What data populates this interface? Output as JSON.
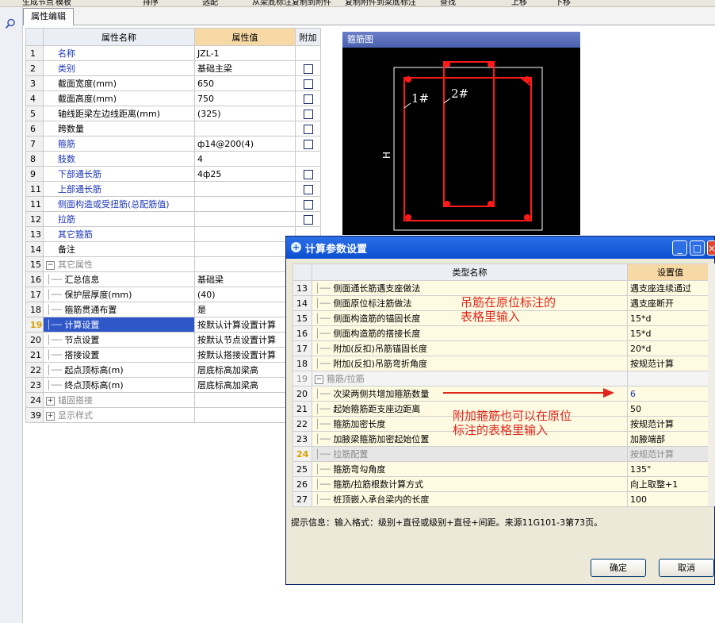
{
  "toolbar": {
    "items": [
      "生成节点",
      "模板",
      "排序",
      "选配",
      "从梁底标注复制到附件",
      "复制附件到梁底标注",
      "查找",
      "上移",
      "下移"
    ]
  },
  "tabs": [
    {
      "label": "属性编辑"
    }
  ],
  "property_grid": {
    "headers": {
      "name": "属性名称",
      "value": "属性值",
      "extra": "附加"
    },
    "rows": [
      {
        "num": "1",
        "name": "名称",
        "value": "JZL-1",
        "style": "blue",
        "checkbox": false
      },
      {
        "num": "2",
        "name": "类别",
        "value": "基础主梁",
        "style": "blue",
        "checkbox": true
      },
      {
        "num": "3",
        "name": "截面宽度(mm)",
        "value": "650",
        "style": "",
        "checkbox": true
      },
      {
        "num": "4",
        "name": "截面高度(mm)",
        "value": "750",
        "style": "",
        "checkbox": true
      },
      {
        "num": "5",
        "name": "轴线距梁左边线距离(mm)",
        "value": "(325)",
        "style": "",
        "checkbox": true
      },
      {
        "num": "6",
        "name": "跨数量",
        "value": "",
        "style": "",
        "checkbox": true
      },
      {
        "num": "7",
        "name": "箍筋",
        "value": "ф14@200(4)",
        "style": "blue",
        "checkbox": true
      },
      {
        "num": "8",
        "name": "肢数",
        "value": "4",
        "style": "blue",
        "checkbox": false
      },
      {
        "num": "9",
        "name": "下部通长筋",
        "value": "4ф25",
        "style": "blue",
        "checkbox": true
      },
      {
        "num": "11",
        "name": "上部通长筋",
        "value": "",
        "style": "blue",
        "checkbox": true
      },
      {
        "num": "11",
        "name": "侧面构造或受扭筋(总配筋值)",
        "value": "",
        "style": "blue",
        "checkbox": true
      },
      {
        "num": "12",
        "name": "拉筋",
        "value": "",
        "style": "blue",
        "checkbox": true
      },
      {
        "num": "13",
        "name": "其它箍筋",
        "value": "",
        "style": "blue",
        "checkbox": false
      },
      {
        "num": "14",
        "name": "备注",
        "value": "",
        "style": "",
        "checkbox": false
      },
      {
        "num": "15",
        "name": "其它属性",
        "value": "",
        "style": "group",
        "toggle": "−",
        "checkbox": false
      },
      {
        "num": "16",
        "name": "汇总信息",
        "value": "基础梁",
        "style": "child",
        "checkbox": false
      },
      {
        "num": "17",
        "name": "保护层厚度(mm)",
        "value": "(40)",
        "style": "child",
        "checkbox": false
      },
      {
        "num": "18",
        "name": "箍筋贯通布置",
        "value": "是",
        "style": "child",
        "checkbox": false
      },
      {
        "num": "19",
        "name": "计算设置",
        "value": "按默认计算设置计算",
        "style": "selected",
        "checkbox": false
      },
      {
        "num": "20",
        "name": "节点设置",
        "value": "按默认节点设置计算",
        "style": "child",
        "checkbox": false
      },
      {
        "num": "21",
        "name": "搭接设置",
        "value": "按默认搭接设置计算",
        "style": "child",
        "checkbox": false
      },
      {
        "num": "22",
        "name": "起点顶标高(m)",
        "value": "层底标高加梁高",
        "style": "child",
        "checkbox": false
      },
      {
        "num": "23",
        "name": "终点顶标高(m)",
        "value": "层底标高加梁高",
        "style": "child",
        "checkbox": false
      },
      {
        "num": "24",
        "name": "锚固搭接",
        "value": "",
        "style": "group",
        "toggle": "+",
        "checkbox": false
      },
      {
        "num": "39",
        "name": "显示样式",
        "value": "",
        "style": "group",
        "toggle": "+",
        "checkbox": false
      }
    ]
  },
  "stirrup_diagram": {
    "title": "箍筋图",
    "label_1": "1#",
    "label_2": "2#",
    "label_h": "H"
  },
  "dialog": {
    "title": "计算参数设置",
    "headers": {
      "name": "类型名称",
      "value": "设置值"
    },
    "rows": [
      {
        "num": "13",
        "name": "侧面通长筋遇支座做法",
        "value": "遇支座连续通过",
        "style": ""
      },
      {
        "num": "14",
        "name": "侧面原位标注筋做法",
        "value": "遇支座断开",
        "style": ""
      },
      {
        "num": "15",
        "name": "侧面构造筋的锚固长度",
        "value": "15*d",
        "style": ""
      },
      {
        "num": "16",
        "name": "侧面构造筋的搭接长度",
        "value": "15*d",
        "style": ""
      },
      {
        "num": "17",
        "name": "附加(反扣)吊筋锚固长度",
        "value": "20*d",
        "style": ""
      },
      {
        "num": "18",
        "name": "附加(反扣)吊筋弯折角度",
        "value": "按规范计算",
        "style": ""
      },
      {
        "num": "19",
        "name": "箍筋/拉筋",
        "value": "",
        "style": "group",
        "toggle": "−"
      },
      {
        "num": "20",
        "name": "次梁两侧共增加箍筋数量",
        "value": "6",
        "style": "blue"
      },
      {
        "num": "21",
        "name": "起始箍筋距支座边距离",
        "value": "50",
        "style": ""
      },
      {
        "num": "22",
        "name": "箍筋加密长度",
        "value": "按规范计算",
        "style": ""
      },
      {
        "num": "23",
        "name": "加腋梁箍筋加密起始位置",
        "value": "加腋端部",
        "style": ""
      },
      {
        "num": "24",
        "name": "拉筋配置",
        "value": "按规范计算",
        "style": "disabled"
      },
      {
        "num": "25",
        "name": "箍筋弯勾角度",
        "value": "135°",
        "style": ""
      },
      {
        "num": "26",
        "name": "箍筋/拉筋根数计算方式",
        "value": "向上取整+1",
        "style": ""
      },
      {
        "num": "27",
        "name": "桩顶嵌入承台梁内的长度",
        "value": "100",
        "style": ""
      }
    ],
    "hint": "提示信息：输入格式：级别+直径或级别+直径+间距。来源11G101-3第73页。",
    "ok_label": "确定",
    "cancel_label": "取消",
    "minimize_label": "_",
    "maximize_label": "□",
    "close_label": "×"
  },
  "annotations": {
    "note1_line1": "吊筋在原位标注的",
    "note1_line2": "表格里输入",
    "note2_line1": "附加箍筋也可以在原位",
    "note2_line2": "标注的表格里输入"
  },
  "colors": {
    "annotation": "#e0261c",
    "rebar": "#ff1a1a",
    "header_value": "#f7d9a5",
    "selection": "#2f57c8",
    "link_text": "#1c36b7"
  }
}
